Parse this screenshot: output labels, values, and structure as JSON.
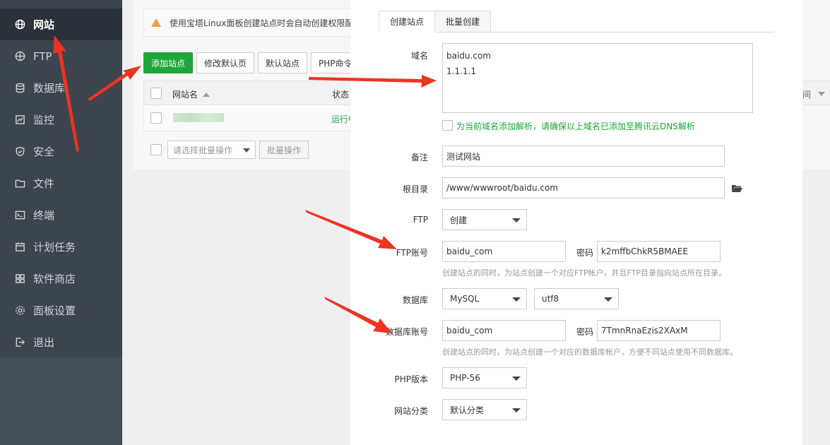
{
  "sidebar": {
    "items": [
      {
        "label": "网站",
        "icon": "globe-icon",
        "active": true
      },
      {
        "label": "FTP",
        "icon": "ftp-icon"
      },
      {
        "label": "数据库",
        "icon": "database-icon"
      },
      {
        "label": "监控",
        "icon": "monitor-icon"
      },
      {
        "label": "安全",
        "icon": "shield-icon"
      },
      {
        "label": "文件",
        "icon": "folder-icon"
      },
      {
        "label": "终端",
        "icon": "terminal-icon"
      },
      {
        "label": "计划任务",
        "icon": "calendar-icon"
      },
      {
        "label": "软件商店",
        "icon": "apps-icon"
      },
      {
        "label": "面板设置",
        "icon": "gear-icon"
      },
      {
        "label": "退出",
        "icon": "logout-icon"
      }
    ]
  },
  "page": {
    "notice": "使用宝塔Linux面板创建站点时会自动创建权限配",
    "toolbar": {
      "add_site": "添加站点",
      "modify_default": "修改默认页",
      "default_site": "默认站点",
      "php_cmd": "PHP命令"
    },
    "table": {
      "col_name": "网站名",
      "col_status": "状态",
      "col_time": "间",
      "row_status": "运行中"
    },
    "batch": {
      "placeholder": "请选择批量操作",
      "button": "批量操作"
    }
  },
  "modal": {
    "tabs": [
      "创建站点",
      "批量创建"
    ],
    "domain": {
      "label": "域名",
      "lines": [
        "baidu.com",
        "1.1.1.1"
      ]
    },
    "dns_check": "为当前域名添加解析，请确保以上域名已添加至腾讯云DNS解析",
    "remark": {
      "label": "备注",
      "value": "测试网站"
    },
    "root": {
      "label": "根目录",
      "value": "/www/wwwroot/baidu.com"
    },
    "ftp": {
      "label": "FTP",
      "value": "创建"
    },
    "ftp_account": {
      "label": "FTP账号",
      "value": "baidu_com",
      "pwd_label": "密码",
      "pwd_value": "k2mffbChkR5BMAEE"
    },
    "ftp_hint": "创建站点的同时，为站点创建一个对应FTP帐户，并且FTP目录指向站点所在目录。",
    "db": {
      "label": "数据库",
      "value": "MySQL",
      "charset": "utf8"
    },
    "db_account": {
      "label": "数据库账号",
      "value": "baidu_com",
      "pwd_label": "密码",
      "pwd_value": "7TmnRnaEzis2XAxM"
    },
    "db_hint": "创建站点的同时，为站点创建一个对应的数据库帐户，方便不同站点使用不同数据库。",
    "php": {
      "label": "PHP版本",
      "value": "PHP-56"
    },
    "category": {
      "label": "网站分类",
      "value": "默认分类"
    }
  },
  "colors": {
    "accent": "#20a53a",
    "arrow": "#ee3322",
    "sidebar": "#3c444d"
  }
}
